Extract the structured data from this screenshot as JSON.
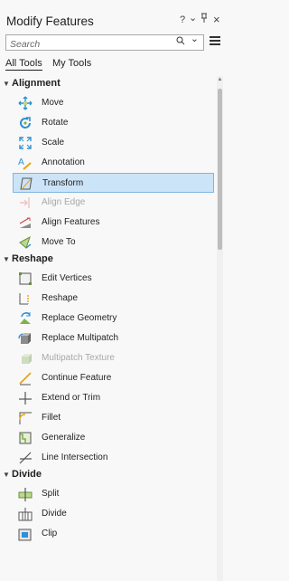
{
  "header": {
    "title": "Modify Features",
    "help": "?",
    "options": "⌄",
    "pin": "ꟷ",
    "close": "×"
  },
  "search": {
    "placeholder": "Search",
    "search_glyph": "⌕",
    "dropdown_glyph": "⌄"
  },
  "tabs": [
    "All Tools",
    "My Tools"
  ],
  "sections": [
    {
      "label": "Alignment",
      "expanded": true,
      "items": [
        {
          "label": "Move",
          "icon": "move-icon"
        },
        {
          "label": "Rotate",
          "icon": "rotate-icon"
        },
        {
          "label": "Scale",
          "icon": "scale-icon"
        },
        {
          "label": "Annotation",
          "icon": "annotation-icon"
        },
        {
          "label": "Transform",
          "icon": "transform-icon",
          "selected": true
        },
        {
          "label": "Align Edge",
          "icon": "align-edge-icon",
          "disabled": true
        },
        {
          "label": "Align Features",
          "icon": "align-features-icon"
        },
        {
          "label": "Move To",
          "icon": "move-to-icon"
        }
      ]
    },
    {
      "label": "Reshape",
      "expanded": true,
      "items": [
        {
          "label": "Edit Vertices",
          "icon": "edit-vertices-icon"
        },
        {
          "label": "Reshape",
          "icon": "reshape-icon"
        },
        {
          "label": "Replace Geometry",
          "icon": "replace-geometry-icon"
        },
        {
          "label": "Replace Multipatch",
          "icon": "replace-multipatch-icon"
        },
        {
          "label": "Multipatch Texture",
          "icon": "multipatch-texture-icon",
          "disabled": true
        },
        {
          "label": "Continue Feature",
          "icon": "continue-feature-icon"
        },
        {
          "label": "Extend or Trim",
          "icon": "extend-trim-icon"
        },
        {
          "label": "Fillet",
          "icon": "fillet-icon"
        },
        {
          "label": "Generalize",
          "icon": "generalize-icon"
        },
        {
          "label": "Line Intersection",
          "icon": "line-intersection-icon"
        }
      ]
    },
    {
      "label": "Divide",
      "expanded": true,
      "items": [
        {
          "label": "Split",
          "icon": "split-icon"
        },
        {
          "label": "Divide",
          "icon": "divide-icon"
        },
        {
          "label": "Clip",
          "icon": "clip-icon"
        }
      ]
    }
  ],
  "colors": {
    "selection_bg": "#cce4f7",
    "selection_border": "#7fb6e0",
    "disabled_text": "#a8a8a8"
  }
}
